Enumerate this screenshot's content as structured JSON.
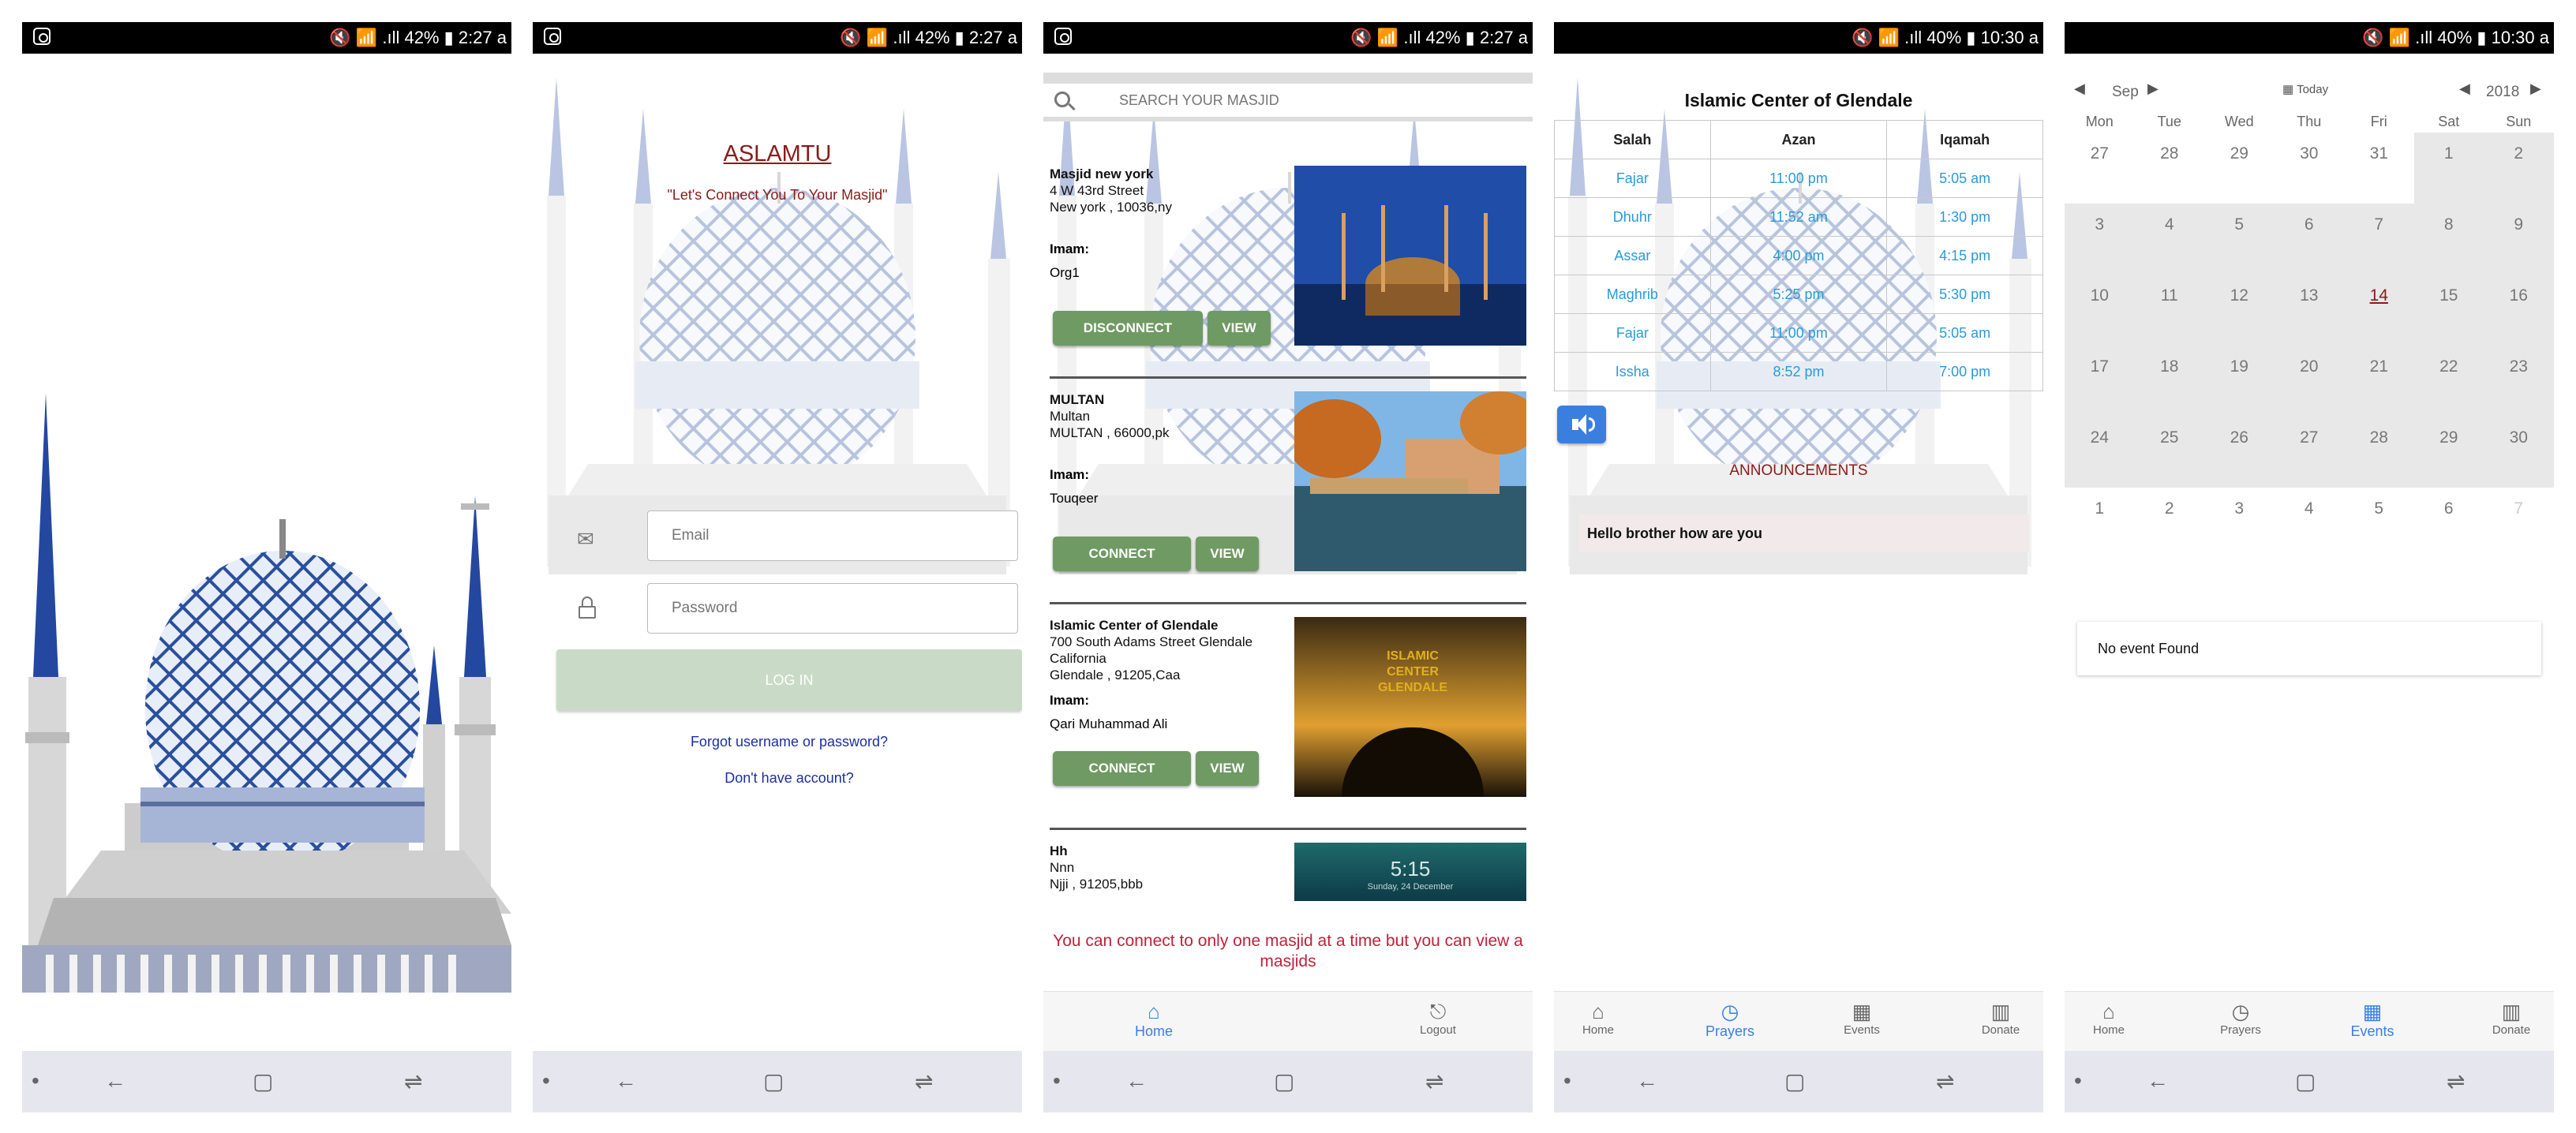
{
  "status_bars": [
    {
      "right": "🔇 📶 .ıll 42% ▮ 2:27 a"
    },
    {
      "right": "🔇 📶 .ıll 42% ▮ 2:27 a"
    },
    {
      "right": "🔇 📶 .ıll 42% ▮ 2:27 a"
    },
    {
      "right": "🔇 📶 .ıll 40% ▮ 10:30 a"
    },
    {
      "right": "🔇 📶 .ıll 40% ▮ 10:30 a"
    }
  ],
  "nav_icons": {
    "dot": "•",
    "back": "←",
    "recents": "▢",
    "switch": "⇌"
  },
  "login": {
    "title": "ASLAMTU",
    "tagline": "\"Let's Connect You To Your Masjid\"",
    "email_placeholder": "Email",
    "password_placeholder": "Password",
    "login_button": "LOG IN",
    "forgot_link": "Forgot username or password?",
    "signup_link": "Don't have account?"
  },
  "masjid_list": {
    "search_placeholder": "SEARCH YOUR MASJID",
    "imam_label": "Imam:",
    "view_label": "VIEW",
    "cards": [
      {
        "name": "Masjid new york",
        "line1": "4 W 43rd Street",
        "line2": "",
        "city": "New york , 10036,ny",
        "imam": "Org1",
        "action": "DISCONNECT"
      },
      {
        "name": "MULTAN",
        "line1": "Multan",
        "line2": "",
        "city": "MULTAN , 66000,pk",
        "imam": "Touqeer",
        "action": "CONNECT"
      },
      {
        "name": "Islamic Center of Glendale",
        "line1": "700 South Adams Street Glendale",
        "line2": "California",
        "city": "Glendale , 91205,Caa",
        "imam": "Qari Muhammad Ali",
        "action": "CONNECT"
      },
      {
        "name": "Hh",
        "line1": "Nnn",
        "line2": "",
        "city": "Njji , 91205,bbb",
        "imam": "",
        "action": ""
      }
    ],
    "photo3_text": "ISLAMIC CENTER GLENDALE",
    "photo4_clock": "5:15",
    "photo4_date": "Sunday, 24 December",
    "warning": "You can connect to only one masjid at a time but you can view a masjids",
    "tabs": [
      {
        "label": "Home",
        "icon": "⌂"
      },
      {
        "label": "Logout",
        "icon": "⎋"
      }
    ]
  },
  "prayers": {
    "title": "Islamic Center of Glendale",
    "headers": [
      "Salah",
      "Azan",
      "Iqamah"
    ],
    "rows": [
      [
        "Fajar",
        "11:00 pm",
        "5:05 am"
      ],
      [
        "Dhuhr",
        "11:52 am",
        "1:30 pm"
      ],
      [
        "Assar",
        "4:00 pm",
        "4:15 pm"
      ],
      [
        "Maghrib",
        "5:25 pm",
        "5:30 pm"
      ],
      [
        "Fajar",
        "11:00 pm",
        "5:05 am"
      ],
      [
        "Issha",
        "8:52 pm",
        "7:00 pm"
      ]
    ],
    "announcements_label": "ANNOUNCEMENTS",
    "announcement": "Hello  brother how are you"
  },
  "bottom_tabs": [
    {
      "label": "Home",
      "icon": "⌂"
    },
    {
      "label": "Prayers",
      "icon": "◷"
    },
    {
      "label": "Events",
      "icon": "▦"
    },
    {
      "label": "Donate",
      "icon": "▥"
    }
  ],
  "calendar": {
    "month": "Sep",
    "today": "Today",
    "year": "2018",
    "weekdays": [
      "Mon",
      "Tue",
      "Wed",
      "Thu",
      "Fri",
      "Sat",
      "Sun"
    ],
    "weeks": [
      [
        "27",
        "28",
        "29",
        "30",
        "31",
        "1",
        "2"
      ],
      [
        "3",
        "4",
        "5",
        "6",
        "7",
        "8",
        "9"
      ],
      [
        "10",
        "11",
        "12",
        "13",
        "14",
        "15",
        "16"
      ],
      [
        "17",
        "18",
        "19",
        "20",
        "21",
        "22",
        "23"
      ],
      [
        "24",
        "25",
        "26",
        "27",
        "28",
        "29",
        "30"
      ],
      [
        "1",
        "2",
        "3",
        "4",
        "5",
        "6",
        "7"
      ]
    ],
    "no_event": "No event Found"
  },
  "colors": {
    "accent_blue": "#3a7fe0",
    "green_button": "#6f9a63",
    "link_blue": "#1c2fa0",
    "maroon": "#8b1a1a",
    "warning_red": "#c0213a"
  }
}
